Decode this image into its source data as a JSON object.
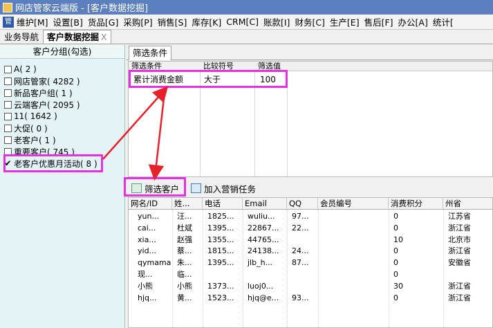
{
  "window": {
    "title": "网店管家云端版 - [客户数据挖掘]"
  },
  "menu": {
    "icon_glyph": "管",
    "items": [
      "维护[M]",
      "设置[B]",
      "货品[G]",
      "采购[P]",
      "销售[S]",
      "库存[K]",
      "CRM[C]",
      "账款[I]",
      "财务[C]",
      "生产[E]",
      "售后[F]",
      "办公[A]",
      "统计["
    ]
  },
  "tabs": {
    "nav": "业务导航",
    "active": "客户数据挖掘",
    "close": "X"
  },
  "left_panel": {
    "header": "客户分组(勾选)",
    "groups": [
      {
        "label": "A( 2 )",
        "checked": false
      },
      {
        "label": "网店管家( 4282 )",
        "checked": false
      },
      {
        "label": "新品客户组( 1 )",
        "checked": false
      },
      {
        "label": "云端客户( 2095 )",
        "checked": false
      },
      {
        "label": "11( 1642 )",
        "checked": false
      },
      {
        "label": "大促( 0 )",
        "checked": false
      },
      {
        "label": "老客户( 1 )",
        "checked": false
      },
      {
        "label": "重要客户( 745 )",
        "checked": false
      },
      {
        "label": "老客户优惠月活动( 8 )",
        "checked": true
      }
    ],
    "check_glyph": "✔"
  },
  "filter": {
    "tab_label": "筛选条件",
    "headers": [
      "筛选条件",
      "比较符号",
      "筛选值"
    ],
    "rows": [
      [
        "累计消费金额",
        "大于",
        "100"
      ]
    ]
  },
  "toolbar": {
    "filter_button": "筛选客户",
    "add_task_button": "加入营销任务"
  },
  "customers": {
    "headers": [
      "网名/ID",
      "姓...",
      "电话",
      "Email",
      "QQ",
      "会员编号",
      "消费积分",
      "州省"
    ],
    "rows": [
      [
        "yun...",
        "汪...",
        "1825...",
        "wuliu...",
        "97...",
        "",
        "0",
        "江苏省"
      ],
      [
        "cai...",
        "杜斌",
        "1395...",
        "22867...",
        "22...",
        "",
        "0",
        "浙江省"
      ],
      [
        "xia...",
        "赵强",
        "1355...",
        "44765...",
        "",
        "",
        "10",
        "北京市"
      ],
      [
        "yid...",
        "蔡...",
        "1815...",
        "24138...",
        "24...",
        "",
        "0",
        "浙江省"
      ],
      [
        "qymama",
        "朱...",
        "1395...",
        "jlb_h...",
        "87...",
        "",
        "0",
        "安徽省"
      ],
      [
        "现...",
        "临...",
        "",
        "",
        "",
        "",
        "0",
        ""
      ],
      [
        "小熊",
        "小熊",
        "1373...",
        "luoj0...",
        "",
        "",
        "30",
        "浙江省"
      ],
      [
        "hjq...",
        "黄...",
        "1523...",
        "hjq@e...",
        "93...",
        "",
        "0",
        "浙江省"
      ]
    ]
  },
  "colors": {
    "annotation": "#e530e5",
    "arrow": "#e8202a",
    "titlebar": "#5b7fbf"
  }
}
